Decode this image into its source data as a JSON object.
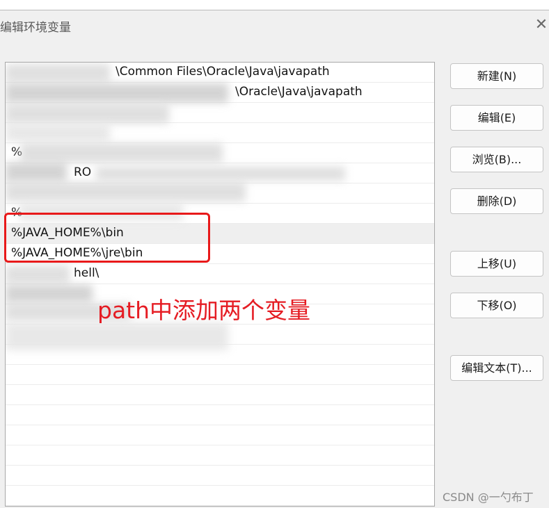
{
  "window": {
    "title": "编辑环境变量",
    "close_glyph": "✕"
  },
  "list": {
    "rows": [
      "",
      "",
      "",
      "",
      "%",
      "",
      "",
      "%",
      "%JAVA_HOME%\\bin",
      "%JAVA_HOME%\\jre\\bin",
      "",
      "",
      "",
      "",
      "",
      "",
      "",
      "",
      "",
      "",
      "",
      ""
    ],
    "partial_fragments": {
      "row0": "\\Common Files\\Oracle\\Java\\javapath",
      "row1": "\\Oracle\\Java\\javapath",
      "row5": "RO",
      "row10": "hell\\"
    }
  },
  "buttons": {
    "new": "新建(N)",
    "edit": "编辑(E)",
    "browse": "浏览(B)...",
    "delete": "删除(D)",
    "move_up": "上移(U)",
    "move_down": "下移(O)",
    "edit_text": "编辑文本(T)..."
  },
  "annotation": {
    "text": "path中添加两个变量",
    "color": "#e51c23"
  },
  "watermark": "CSDN @一勺布丁"
}
